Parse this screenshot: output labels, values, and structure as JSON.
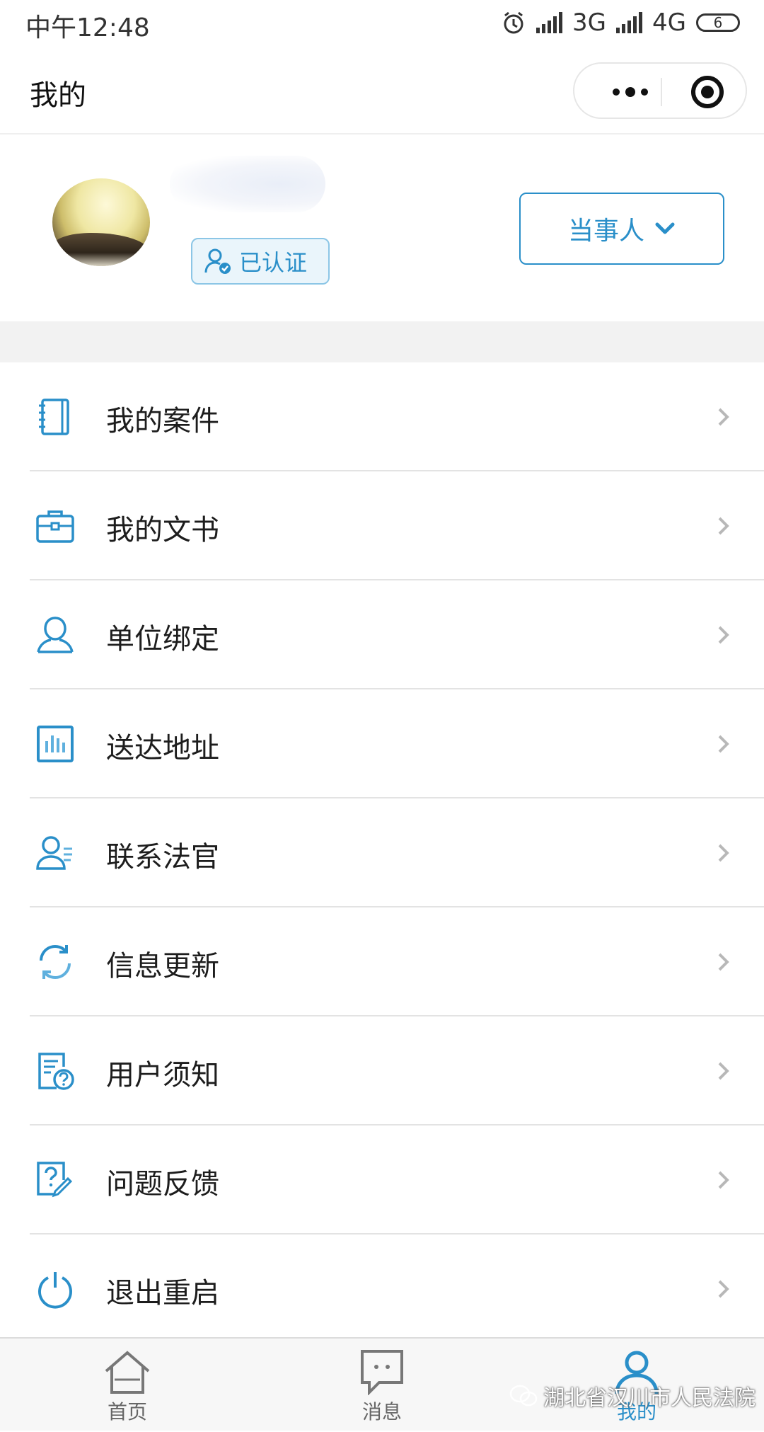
{
  "status_bar": {
    "time": "中午12:48",
    "network_1": "3G",
    "network_2": "4G",
    "battery": "6"
  },
  "nav": {
    "title": "我的"
  },
  "profile": {
    "verified_label": "已认证",
    "role_label": "当事人"
  },
  "menu": {
    "items": [
      {
        "label": "我的案件",
        "icon": "notebook-icon"
      },
      {
        "label": "我的文书",
        "icon": "briefcase-icon"
      },
      {
        "label": "单位绑定",
        "icon": "person-icon"
      },
      {
        "label": "送达地址",
        "icon": "bar-chart-icon"
      },
      {
        "label": "联系法官",
        "icon": "contact-person-icon"
      },
      {
        "label": "信息更新",
        "icon": "refresh-icon"
      },
      {
        "label": "用户须知",
        "icon": "document-question-icon"
      },
      {
        "label": "问题反馈",
        "icon": "feedback-edit-icon"
      },
      {
        "label": "退出重启",
        "icon": "power-icon"
      }
    ]
  },
  "tabbar": {
    "tabs": [
      {
        "label": "首页",
        "icon": "home-icon",
        "active": false
      },
      {
        "label": "消息",
        "icon": "message-icon",
        "active": false
      },
      {
        "label": "我的",
        "icon": "user-icon",
        "active": true
      }
    ]
  },
  "watermark": "湖北省汉川市人民法院",
  "colors": {
    "accent": "#2a8fc9",
    "divider": "#e3e3e3",
    "band": "#f2f2f2"
  }
}
